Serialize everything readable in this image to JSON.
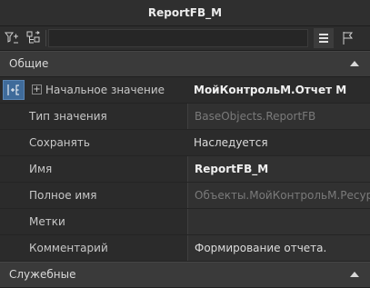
{
  "window": {
    "title": "ReportFB_M"
  },
  "toolbar": {
    "filter_icon": "filter-icon",
    "tree_icon": "tree-expand-icon",
    "list_icon": "list-view-icon",
    "flag_icon": "flag-icon"
  },
  "sections": {
    "general": "Общие",
    "service": "Служебные"
  },
  "properties": [
    {
      "name": "Начальное значение",
      "value": "МойКонтрольМ.Отчет М",
      "style": "bold"
    },
    {
      "name": "Тип значения",
      "value": "BaseObjects.ReportFB",
      "style": "dim"
    },
    {
      "name": "Сохранять",
      "value": "Наследуется",
      "style": "normal"
    },
    {
      "name": "Имя",
      "value": "ReportFB_M",
      "style": "bold"
    },
    {
      "name": "Полное имя",
      "value": "Объекты.МойКонтрольМ.Ресурсы",
      "style": "dim"
    },
    {
      "name": "Метки",
      "value": "",
      "style": "normal"
    },
    {
      "name": "Комментарий",
      "value": "Формирование отчета.",
      "style": "normal"
    }
  ]
}
